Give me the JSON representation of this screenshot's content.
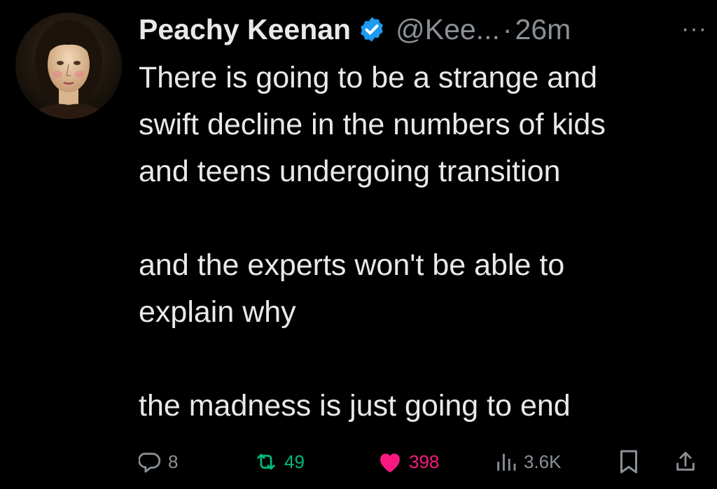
{
  "author": {
    "display_name": "Peachy Keenan",
    "handle": "@Kee...",
    "separator": "·",
    "time": "26m",
    "verified_color": "#1d9bf0",
    "avatar_icon": "portrait-avatar"
  },
  "more_label": "···",
  "tweet": {
    "paragraphs": [
      [
        "There is going to be a strange and",
        "swift decline in the numbers of kids",
        "and teens undergoing transition"
      ],
      [
        "and the experts won't be able to",
        "explain why"
      ],
      [
        "the madness is just going to end"
      ]
    ]
  },
  "actions": {
    "replies": "8",
    "retweets": "49",
    "likes": "398",
    "views": "3.6K",
    "reply_icon": "speech-bubble-icon",
    "retweet_icon": "retweet-arrows-icon",
    "like_icon": "heart-icon",
    "views_icon": "bar-chart-icon",
    "bookmark_icon": "bookmark-icon",
    "share_icon": "share-upload-icon",
    "colors": {
      "muted": "#8b9096",
      "retweet": "#00ba7c",
      "like": "#f91880"
    }
  }
}
